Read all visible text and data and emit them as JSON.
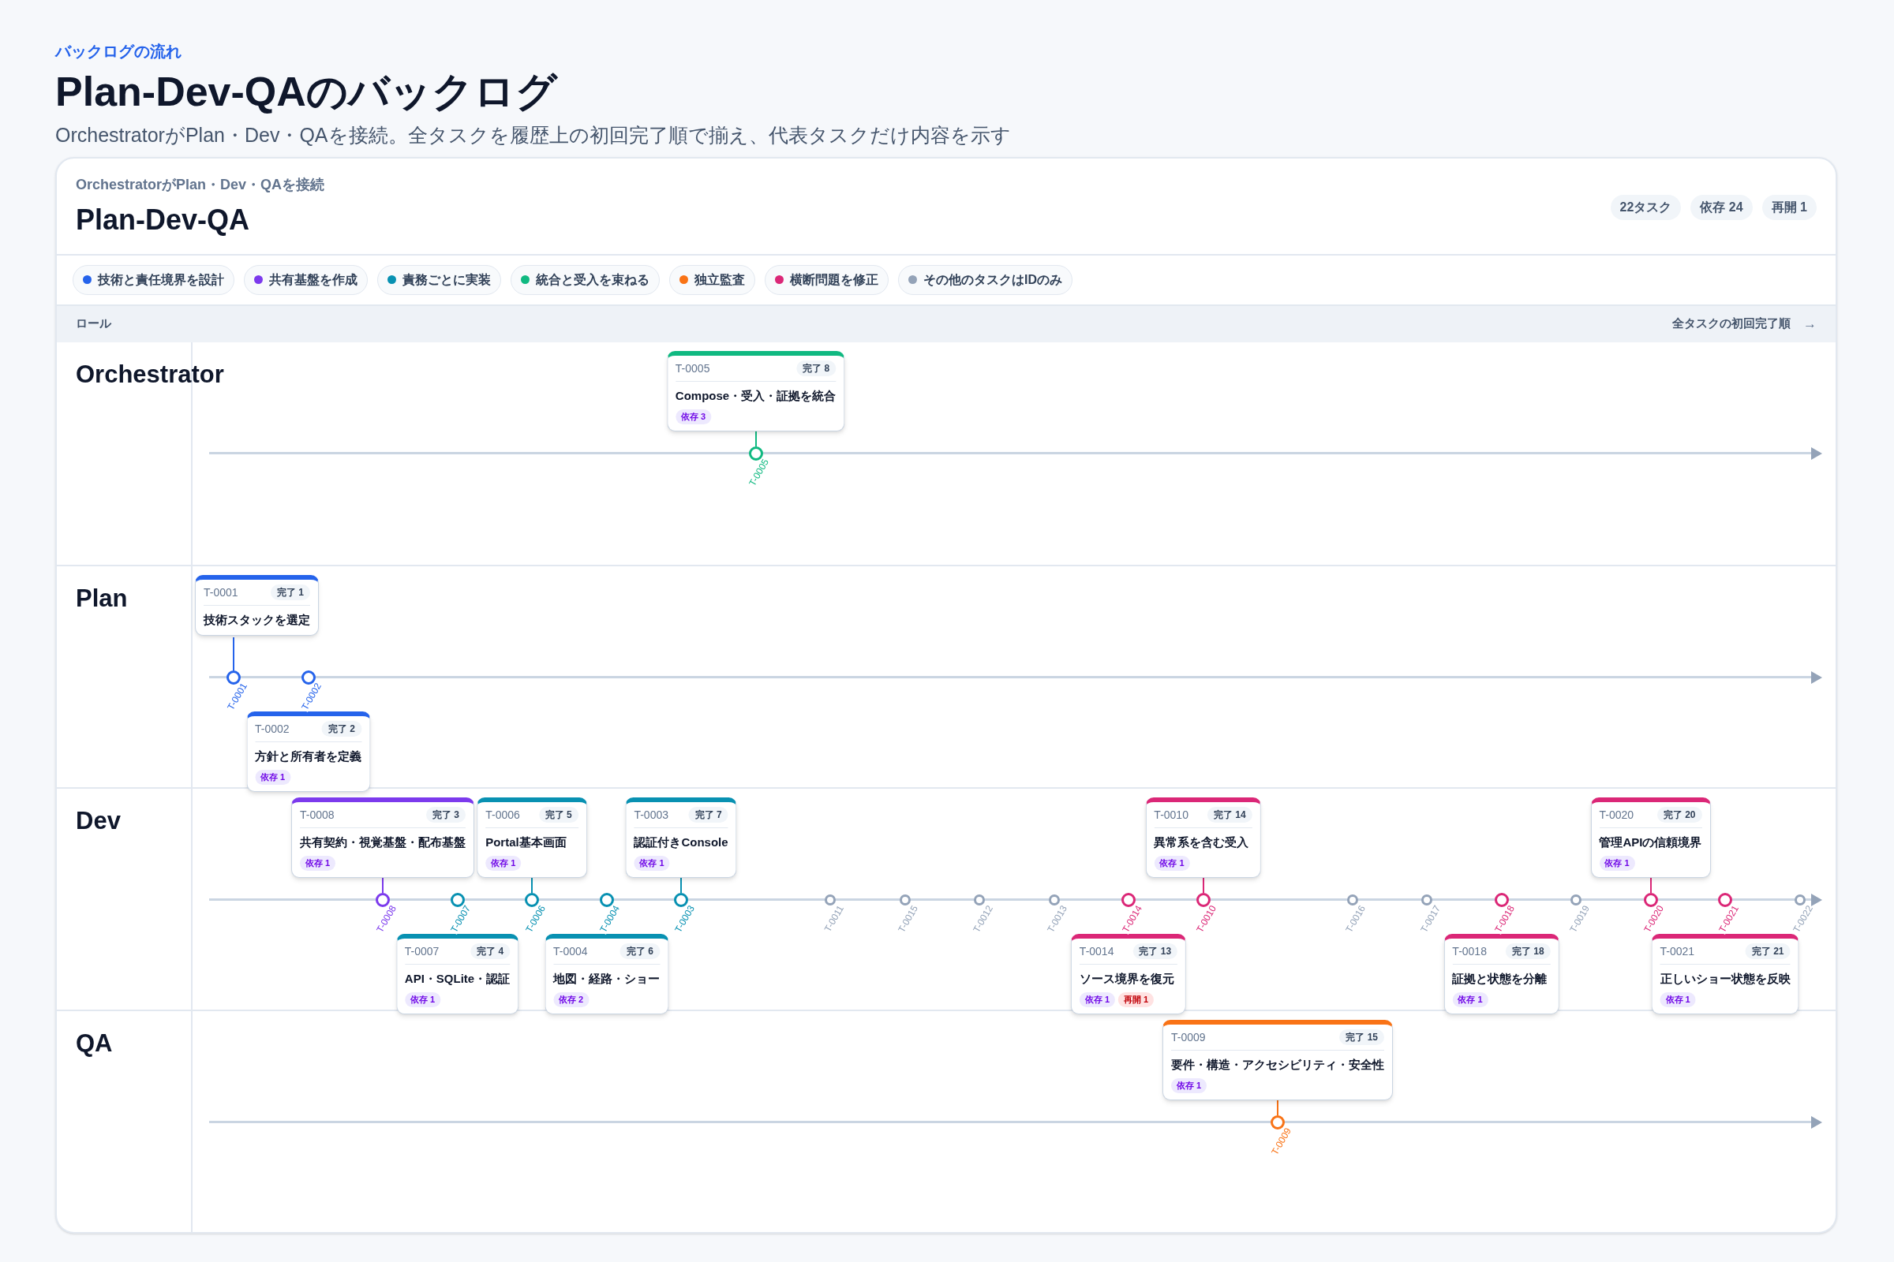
{
  "header": {
    "eyebrow": "バックログの流れ",
    "title": "Plan-Dev-QAのバックログ",
    "subtitle": "OrchestratorがPlan・Dev・QAを接続。全タスクを履歴上の初回完了順で揃え、代表タスクだけ内容を示す"
  },
  "board": {
    "subtitle": "OrchestratorがPlan・Dev・QAを接続",
    "title": "Plan-Dev-QA",
    "stats": [
      "22タスク",
      "依存 24",
      "再開 1"
    ],
    "legend": [
      {
        "label": "技術と責任境界を設計",
        "color": "#2563eb"
      },
      {
        "label": "共有基盤を作成",
        "color": "#7c3aed"
      },
      {
        "label": "責務ごとに実装",
        "color": "#0891b2"
      },
      {
        "label": "統合と受入を束ねる",
        "color": "#10b981"
      },
      {
        "label": "独立監査",
        "color": "#f97316"
      },
      {
        "label": "横断問題を修正",
        "color": "#db2777"
      },
      {
        "label": "その他のタスクはIDのみ",
        "color": "#94a3b8"
      }
    ],
    "column_header": {
      "left": "ロール",
      "right": "全タスクの初回完了順",
      "arrow": "→"
    },
    "lanes": [
      {
        "kind": "orchestrator",
        "name": "Orchestrator"
      },
      {
        "kind": "plan",
        "name": "Plan"
      },
      {
        "kind": "dev",
        "name": "Dev"
      },
      {
        "kind": "qa",
        "name": "QA"
      }
    ],
    "tasks": [
      {
        "kind": "plan",
        "id": "T-0001",
        "color": "#2563eb",
        "card": {
          "above": true,
          "id": "T-0001",
          "done": "完了 1",
          "title": "技術スタックを選定"
        }
      },
      {
        "kind": "plan",
        "id": "T-0002",
        "color": "#2563eb",
        "card": {
          "above": false,
          "id": "T-0002",
          "done": "完了 2",
          "title": "方針と所有者を定義",
          "tags": [
            {
              "kind": "deps",
              "text": "依存 1"
            }
          ]
        }
      },
      {
        "kind": "dev",
        "id": "T-0008",
        "color": "#7c3aed",
        "card": {
          "above": true,
          "id": "T-0008",
          "done": "完了 3",
          "title": "共有契約・視覚基盤・配布基盤",
          "tags": [
            {
              "kind": "deps",
              "text": "依存 1"
            }
          ]
        }
      },
      {
        "kind": "dev",
        "id": "T-0007",
        "color": "#0891b2",
        "card": {
          "above": false,
          "id": "T-0007",
          "done": "完了 4",
          "title": "API・SQLite・認証",
          "tags": [
            {
              "kind": "deps",
              "text": "依存 1"
            }
          ]
        }
      },
      {
        "kind": "dev",
        "id": "T-0006",
        "color": "#0891b2",
        "card": {
          "above": true,
          "id": "T-0006",
          "done": "完了 5",
          "title": "Portal基本画面",
          "tags": [
            {
              "kind": "deps",
              "text": "依存 1"
            }
          ]
        }
      },
      {
        "kind": "dev",
        "id": "T-0004",
        "color": "#0891b2",
        "card": {
          "above": false,
          "id": "T-0004",
          "done": "完了 6",
          "title": "地図・経路・ショー",
          "tags": [
            {
              "kind": "deps",
              "text": "依存 2"
            }
          ]
        }
      },
      {
        "kind": "dev",
        "id": "T-0003",
        "color": "#0891b2",
        "card": {
          "above": true,
          "id": "T-0003",
          "done": "完了 7",
          "title": "認証付きConsole",
          "tags": [
            {
              "kind": "deps",
              "text": "依存 1"
            }
          ]
        }
      },
      {
        "kind": "orchestrator",
        "id": "T-0005",
        "color": "#10b981",
        "card": {
          "above": true,
          "id": "T-0005",
          "done": "完了 8",
          "title": "Compose・受入・証拠を統合",
          "tags": [
            {
              "kind": "deps",
              "text": "依存 3"
            }
          ]
        }
      },
      {
        "kind": "dev",
        "id": "T-0011",
        "color": "#94a3b8"
      },
      {
        "kind": "dev",
        "id": "T-0015",
        "color": "#94a3b8"
      },
      {
        "kind": "dev",
        "id": "T-0012",
        "color": "#94a3b8"
      },
      {
        "kind": "dev",
        "id": "T-0013",
        "color": "#94a3b8"
      },
      {
        "kind": "dev",
        "id": "T-0014",
        "color": "#db2777",
        "card": {
          "above": false,
          "id": "T-0014",
          "done": "完了 13",
          "title": "ソース境界を復元",
          "tags": [
            {
              "kind": "deps",
              "text": "依存 1"
            },
            {
              "kind": "reopen",
              "text": "再開 1"
            }
          ]
        }
      },
      {
        "kind": "dev",
        "id": "T-0010",
        "color": "#db2777",
        "card": {
          "above": true,
          "id": "T-0010",
          "done": "完了 14",
          "title": "異常系を含む受入",
          "tags": [
            {
              "kind": "deps",
              "text": "依存 1"
            }
          ]
        }
      },
      {
        "kind": "qa",
        "id": "T-0009",
        "color": "#f97316",
        "card": {
          "above": true,
          "id": "T-0009",
          "done": "完了 15",
          "title": "要件・構造・アクセシビリティ・安全性",
          "tags": [
            {
              "kind": "deps",
              "text": "依存 1"
            }
          ]
        }
      },
      {
        "kind": "dev",
        "id": "T-0016",
        "color": "#94a3b8"
      },
      {
        "kind": "dev",
        "id": "T-0017",
        "color": "#94a3b8"
      },
      {
        "kind": "dev",
        "id": "T-0018",
        "color": "#db2777",
        "card": {
          "above": false,
          "id": "T-0018",
          "done": "完了 18",
          "title": "証拠と状態を分離",
          "tags": [
            {
              "kind": "deps",
              "text": "依存 1"
            }
          ]
        }
      },
      {
        "kind": "dev",
        "id": "T-0019",
        "color": "#94a3b8"
      },
      {
        "kind": "dev",
        "id": "T-0020",
        "color": "#db2777",
        "card": {
          "above": true,
          "id": "T-0020",
          "done": "完了 20",
          "title": "管理APIの信頼境界",
          "tags": [
            {
              "kind": "deps",
              "text": "依存 1"
            }
          ]
        }
      },
      {
        "kind": "dev",
        "id": "T-0021",
        "color": "#db2777",
        "card": {
          "above": false,
          "id": "T-0021",
          "done": "完了 21",
          "title": "正しいショー状態を反映",
          "tags": [
            {
              "kind": "deps",
              "text": "依存 1"
            }
          ]
        }
      },
      {
        "kind": "dev",
        "id": "T-0022",
        "color": "#94a3b8"
      }
    ]
  }
}
